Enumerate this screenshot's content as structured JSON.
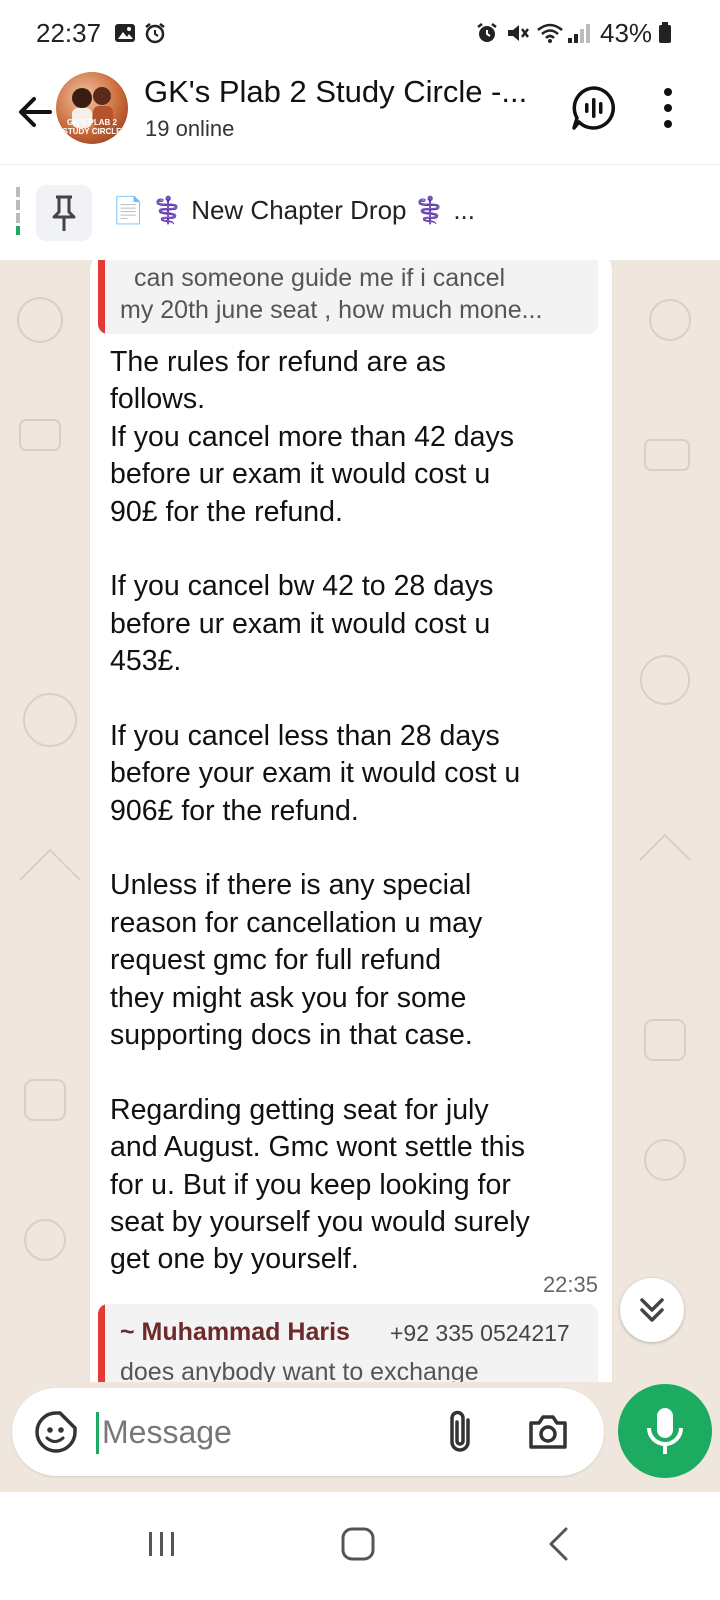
{
  "status_bar": {
    "time": "22:37",
    "battery_percent": "43%",
    "icons": [
      "gallery-icon",
      "alarm-icon",
      "alarm-icon",
      "mute-icon",
      "wifi-icon",
      "signal-icon",
      "battery-icon"
    ]
  },
  "header": {
    "title": "GK's Plab 2 Study Circle -...",
    "subtitle": "19 online",
    "avatar_text": "GK'S PLAB 2 STUDY CIRCLE",
    "icons": [
      "back-arrow-icon",
      "voice-chat-icon",
      "more-vert-icon"
    ]
  },
  "pinned": {
    "text": "📄 ⚕️ New Chapter Drop ⚕️ ...",
    "icons": [
      "pin-icon"
    ]
  },
  "messages": [
    {
      "quote": {
        "line1": "can someone guide me if i cancel",
        "line2": "my 20th june seat , how much mone..."
      },
      "lines": [
        "The rules for refund are as",
        "follows.",
        "If you cancel more than 42 days",
        "before ur exam it would cost u",
        "90£ for the refund.",
        "",
        "If you cancel bw 42 to 28 days",
        "before ur exam it would cost u",
        "453£.",
        "",
        "If you cancel less than 28 days",
        "before your exam it would cost u",
        "906£ for the refund.",
        "",
        "Unless if there is any special",
        "reason for cancellation u may",
        "request gmc for full refund",
        "they might ask you for some",
        "supporting docs in that case.",
        "",
        "Regarding getting seat for july",
        "and August. Gmc wont settle this",
        "for u. But if you keep looking for",
        "seat by yourself you would surely",
        "get one by yourself."
      ],
      "time": "22:35"
    },
    {
      "quote": {
        "author": "~ Muhammad Haris",
        "phone": "+92 335 0524217",
        "text": "does anybody want to exchange"
      }
    }
  ],
  "input": {
    "placeholder": "Message",
    "icons": [
      "sticker-icon",
      "attach-icon",
      "camera-icon",
      "mic-icon"
    ]
  },
  "nav": {
    "icons": [
      "recent-apps-icon",
      "home-icon",
      "back-icon"
    ]
  },
  "colors": {
    "accent_green": "#1daa61",
    "quote_bar_red": "#e53935",
    "chat_bg": "#efe7dd",
    "author_color": "#6d2a2a"
  }
}
